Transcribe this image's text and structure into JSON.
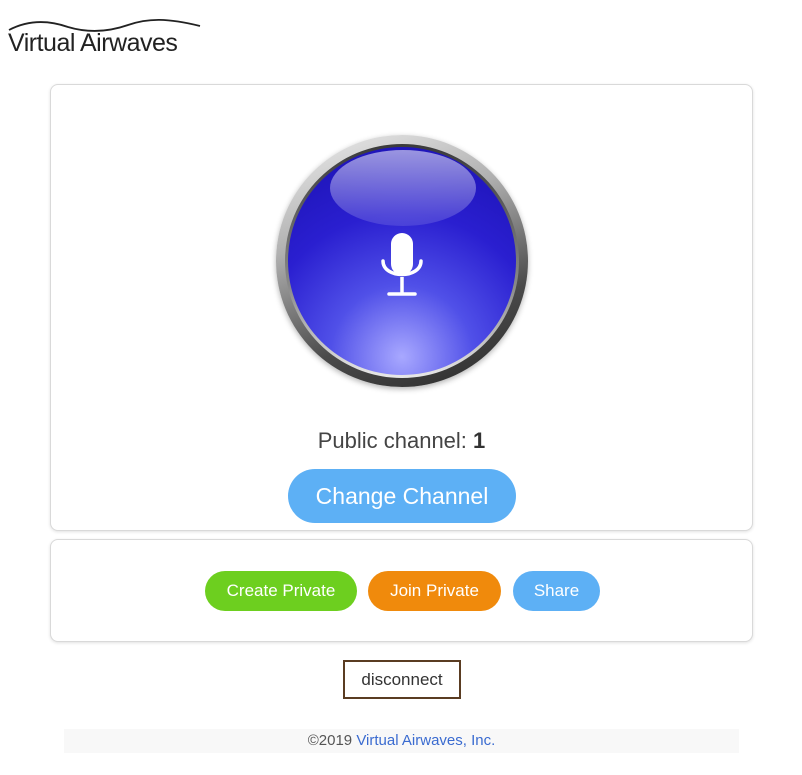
{
  "brand": {
    "name": "Virtual Airwaves"
  },
  "main": {
    "mic_icon": "microphone-icon",
    "channel_label": "Public channel:",
    "channel_number": "1",
    "change_channel_label": "Change Channel"
  },
  "actions": {
    "create_private_label": "Create Private",
    "join_private_label": "Join Private",
    "share_label": "Share"
  },
  "disconnect_label": "disconnect",
  "footer": {
    "copyright": "©2019",
    "company_link": "Virtual Airwaves, Inc."
  },
  "colors": {
    "change_channel": "#5db0f5",
    "create_private": "#6dcf1f",
    "join_private": "#f08a0c",
    "share": "#5db0f5",
    "mic_blue": "#2a1fd0",
    "disconnect_border": "#5a3c22",
    "link": "#3a6bd0"
  }
}
